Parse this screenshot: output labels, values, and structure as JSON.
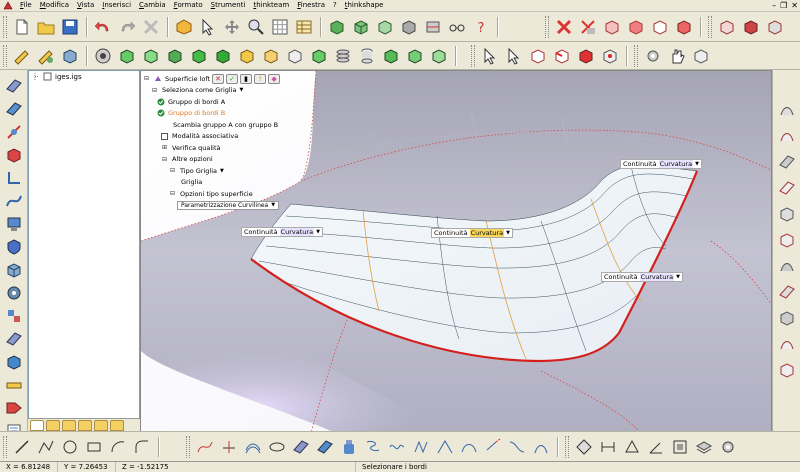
{
  "menubar": {
    "items": [
      "File",
      "Modifica",
      "Vista",
      "Inserisci",
      "Cambia",
      "Formato",
      "Strumenti",
      "thinkteam",
      "Finestra",
      "?",
      "thinkshape"
    ],
    "window_controls": [
      "–",
      "❐",
      "✕"
    ]
  },
  "tree": {
    "root": "iges.igs"
  },
  "property_panel": {
    "title": "Superficie loft",
    "select_mode_label": "Seleziona come Griglia",
    "group_a": "Gruppo di bordi A",
    "group_b": "Gruppo di bordi B",
    "swap_label": "Scambia gruppo A con gruppo B",
    "assoc_label": "Modalità associativa",
    "quality_label": "Verifica qualità",
    "other_options": "Altre opzioni",
    "grid_type_label": "Tipo Griglia",
    "grid_value": "Griglia",
    "surface_options": "Opzioni tipo superficie",
    "param_value": "Parametrizzazione Curvilinea"
  },
  "continuity_labels": [
    {
      "prefix": "Continuità",
      "value": "Curvatura"
    },
    {
      "prefix": "Continuità",
      "value": "Curvatura"
    },
    {
      "prefix": "Continuità",
      "value": "Curvatura"
    },
    {
      "prefix": "Continuità",
      "value": "Curvatura"
    }
  ],
  "status": {
    "x": "X = 6.81248",
    "y": "Y = 7.26453",
    "z": "Z = -1.52175",
    "message": "Selezionare i bordi"
  },
  "colors": {
    "accent_red": "#d4201c",
    "surface_blue": "#eef4f8",
    "highlight_orange": "#f9d65a"
  }
}
